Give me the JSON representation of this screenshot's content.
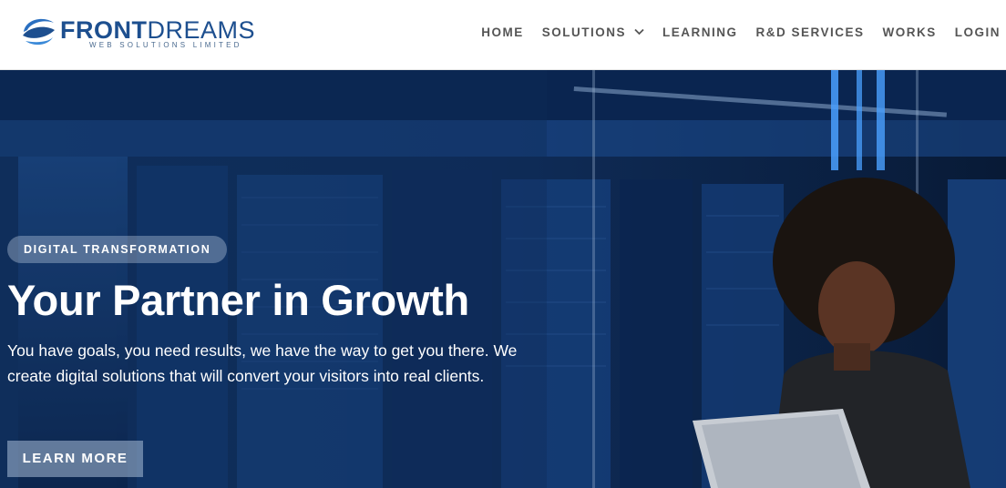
{
  "brand": {
    "name_front": "FRONT",
    "name_rest": "DREAMS",
    "tagline": "WEB SOLUTIONS LIMITED",
    "color": "#1d4f8f"
  },
  "nav": {
    "items": [
      {
        "label": "HOME"
      },
      {
        "label": "SOLUTIONS",
        "icon": "chevron-down-icon"
      },
      {
        "label": "LEARNING"
      },
      {
        "label": "R&D SERVICES"
      },
      {
        "label": "WORKS"
      },
      {
        "label": "LOGIN"
      }
    ]
  },
  "hero": {
    "badge": "DIGITAL TRANSFORMATION",
    "title": "Your Partner in Growth",
    "subtitle": "You have goals, you need results, we have the way to get you there. We create digital solutions that will convert your visitors into real clients.",
    "cta_label": "LEARN MORE",
    "image": "photo of a woman using a laptop in a server room",
    "overlay_color": "#0d2a55"
  }
}
